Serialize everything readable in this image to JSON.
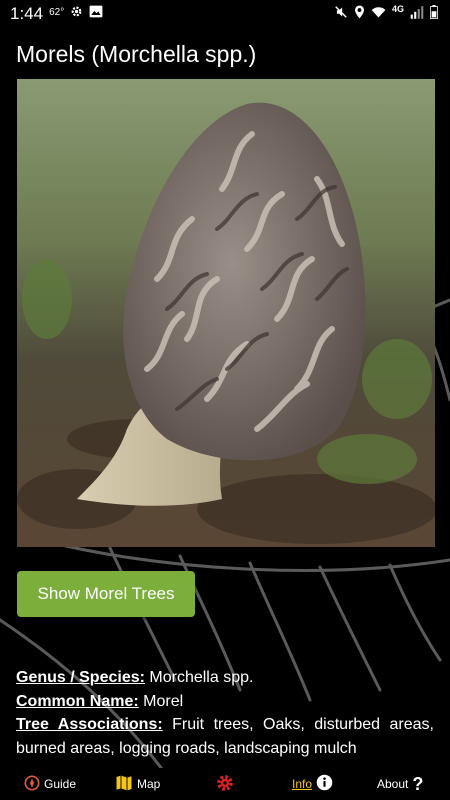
{
  "status_bar": {
    "time": "1:44",
    "temperature": "62°",
    "network": "4G"
  },
  "page": {
    "title": "Morels (Morchella spp.)"
  },
  "actions": {
    "show_trees_label": "Show Morel Trees"
  },
  "info": {
    "genus_label": "Genus / Species:",
    "genus_value": " Morchella spp.",
    "common_label": "Common Name:",
    "common_value": " Morel",
    "trees_label": "Tree Associations:",
    "trees_value": " Fruit trees, Oaks, disturbed areas, burned areas, logging roads, landscaping mulch"
  },
  "bottom_nav": {
    "items": [
      {
        "label": "Guide",
        "icon": "compass-icon"
      },
      {
        "label": "Map",
        "icon": "map-icon"
      },
      {
        "label": "",
        "icon": "gear-icon"
      },
      {
        "label": "Info",
        "icon": "info-icon"
      },
      {
        "label": "About",
        "icon": "question-icon"
      }
    ]
  },
  "colors": {
    "accent_green": "#7cae3c",
    "nav_yellow": "#f5c518",
    "nav_red": "#e02020",
    "background": "#000000"
  }
}
